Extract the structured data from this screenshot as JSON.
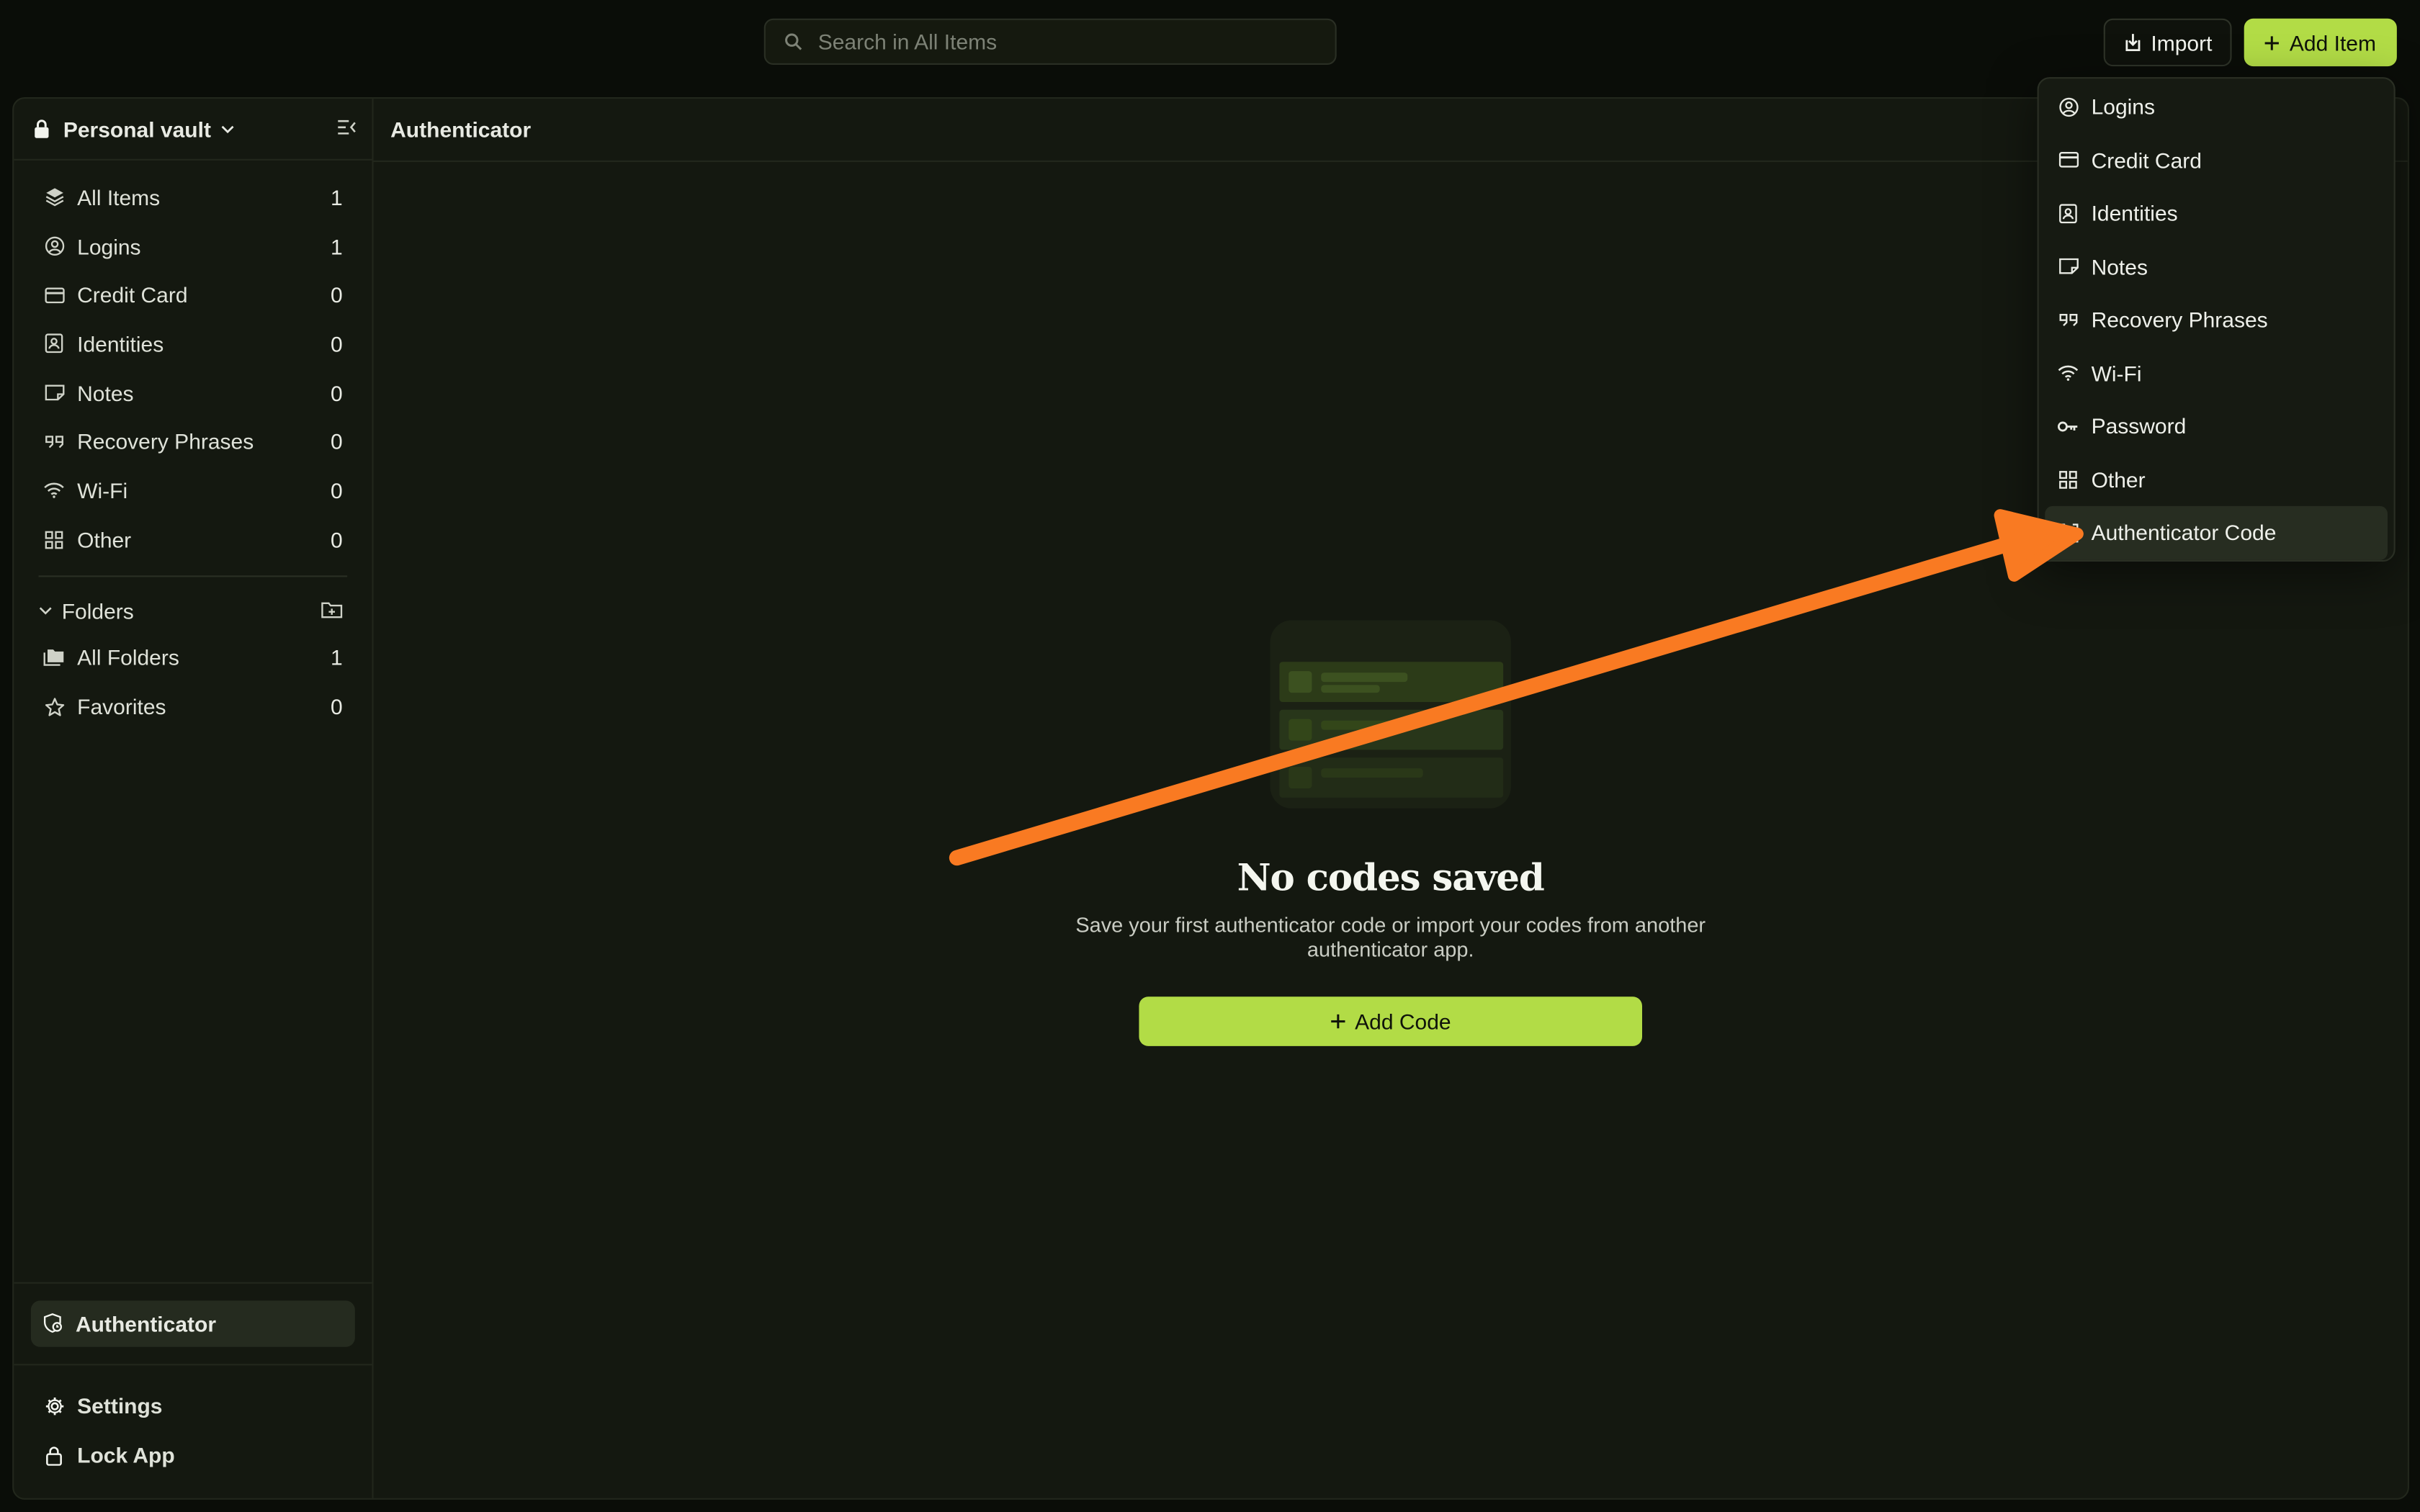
{
  "search": {
    "placeholder": "Search in All Items"
  },
  "toolbar": {
    "import_label": "Import",
    "add_item_label": "Add Item"
  },
  "sidebar": {
    "vault_name": "Personal vault",
    "items": [
      {
        "label": "All Items",
        "count": "1",
        "icon": "layers-icon"
      },
      {
        "label": "Logins",
        "count": "1",
        "icon": "user-circle-icon"
      },
      {
        "label": "Credit Card",
        "count": "0",
        "icon": "credit-card-icon"
      },
      {
        "label": "Identities",
        "count": "0",
        "icon": "id-badge-icon"
      },
      {
        "label": "Notes",
        "count": "0",
        "icon": "note-icon"
      },
      {
        "label": "Recovery Phrases",
        "count": "0",
        "icon": "quote-icon"
      },
      {
        "label": "Wi-Fi",
        "count": "0",
        "icon": "wifi-icon"
      },
      {
        "label": "Other",
        "count": "0",
        "icon": "grid-icon"
      }
    ],
    "folders_label": "Folders",
    "folders": [
      {
        "label": "All Folders",
        "count": "1",
        "icon": "folders-icon"
      },
      {
        "label": "Favorites",
        "count": "0",
        "icon": "star-icon"
      }
    ],
    "authenticator_label": "Authenticator",
    "settings_label": "Settings",
    "lock_label": "Lock App"
  },
  "content": {
    "title": "Authenticator",
    "empty_title": "No codes saved",
    "empty_subtitle": "Save your first authenticator code or import your codes from another authenticator app.",
    "add_code_label": "Add Code"
  },
  "menu": {
    "items": [
      {
        "label": "Logins",
        "icon": "user-circle-icon"
      },
      {
        "label": "Credit Card",
        "icon": "credit-card-icon"
      },
      {
        "label": "Identities",
        "icon": "id-badge-icon"
      },
      {
        "label": "Notes",
        "icon": "note-icon"
      },
      {
        "label": "Recovery Phrases",
        "icon": "quote-icon"
      },
      {
        "label": "Wi-Fi",
        "icon": "wifi-icon"
      },
      {
        "label": "Password",
        "icon": "key-icon"
      },
      {
        "label": "Other",
        "icon": "grid-icon"
      },
      {
        "label": "Authenticator Code",
        "icon": "scan-icon"
      }
    ],
    "highlighted": "Authenticator Code"
  },
  "colors": {
    "accent": "#b2dc46",
    "annotation_arrow": "#f97a22",
    "background": "#0a0d08"
  }
}
